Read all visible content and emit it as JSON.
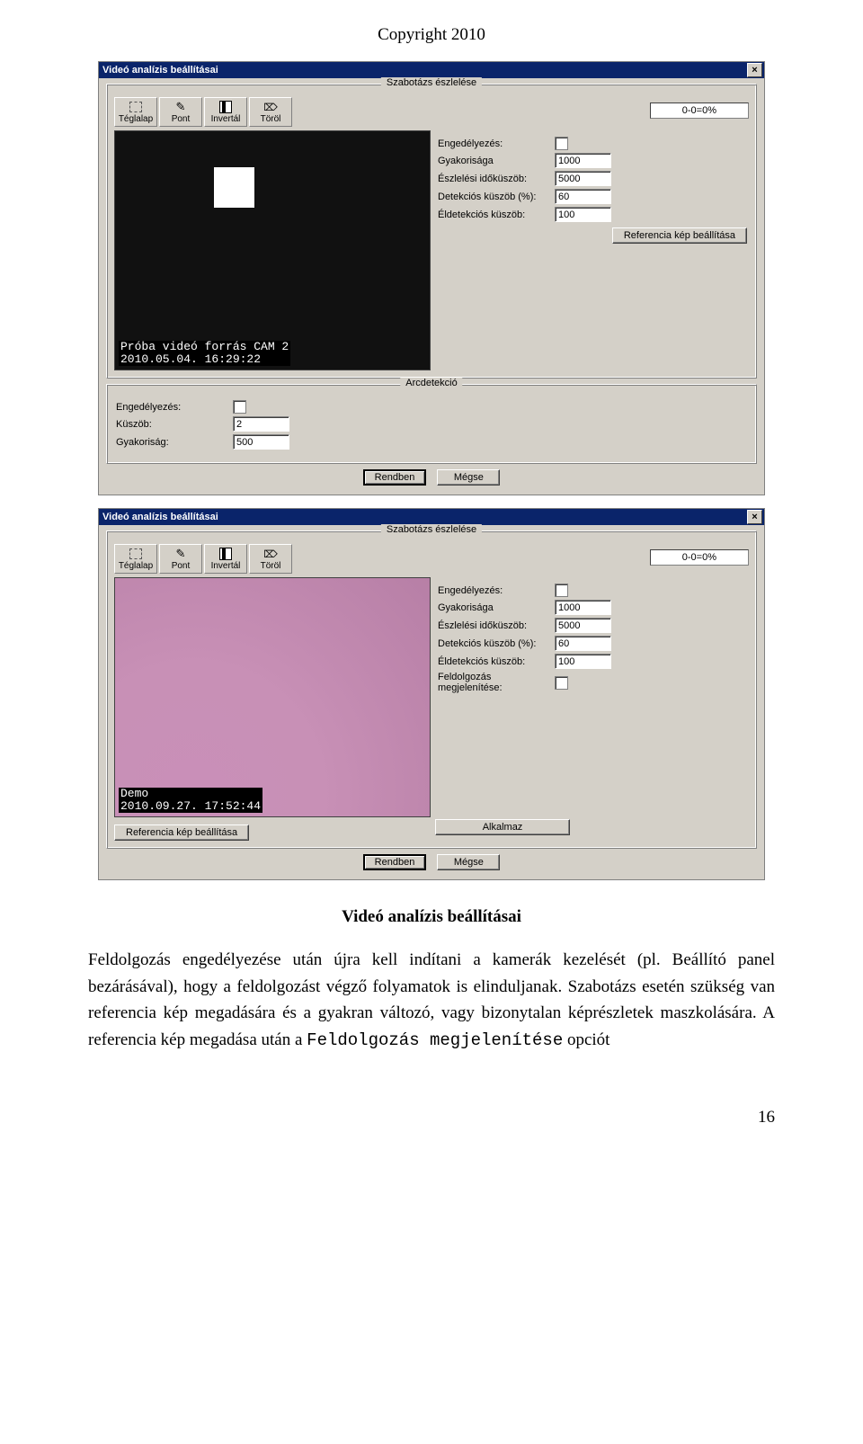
{
  "header": "Copyright 2010",
  "dialog1": {
    "title": "Videó analízis beállításai",
    "sabotage_legend": "Szabotázs észlelése",
    "face_legend": "Arcdetekció",
    "toolbar": {
      "rect": "Téglalap",
      "point": "Pont",
      "invert": "Invertál",
      "erase": "Töröl"
    },
    "status": "0-0=0%",
    "osd_line1": "Próba videó forrás CAM 2",
    "osd_line2": "2010.05.04. 16:29:22",
    "labels": {
      "enable": "Engedélyezés:",
      "freq": "Gyakorisága",
      "detect_time": "Észlelési időküszöb:",
      "detect_thresh": "Detekciós küszöb (%):",
      "edge_thresh": "Éldetekciós küszöb:"
    },
    "values": {
      "freq": "1000",
      "detect_time": "5000",
      "detect_thresh": "60",
      "edge_thresh": "100"
    },
    "ref_button": "Referencia kép beállítása",
    "face": {
      "labels": {
        "enable": "Engedélyezés:",
        "thresh": "Küszöb:",
        "freq": "Gyakoriság:"
      },
      "values": {
        "thresh": "2",
        "freq": "500"
      }
    },
    "buttons": {
      "ok": "Rendben",
      "cancel": "Mégse"
    }
  },
  "dialog2": {
    "title": "Videó analízis beállításai",
    "sabotage_legend": "Szabotázs észlelése",
    "toolbar": {
      "rect": "Téglalap",
      "point": "Pont",
      "invert": "Invertál",
      "erase": "Töröl"
    },
    "status": "0-0=0%",
    "osd_line1": "Demo",
    "osd_line2": "2010.09.27. 17:52:44",
    "labels": {
      "enable": "Engedélyezés:",
      "freq": "Gyakorisága",
      "detect_time": "Észlelési időküszöb:",
      "detect_thresh": "Detekciós küszöb (%):",
      "edge_thresh": "Éldetekciós küszöb:",
      "show_proc": "Feldolgozás megjelenítése:"
    },
    "values": {
      "freq": "1000",
      "detect_time": "5000",
      "detect_thresh": "60",
      "edge_thresh": "100"
    },
    "ref_button": "Referencia kép beállítása",
    "apply_button": "Alkalmaz",
    "buttons": {
      "ok": "Rendben",
      "cancel": "Mégse"
    }
  },
  "body": {
    "caption": "Videó analízis beállításai",
    "p1a": "Feldolgozás engedélyezése után újra kell indítani a kamerák kezelését (pl. Beállító panel bezárásával), hogy a feldolgozást végző folyamatok is elinduljanak. Szabotázs esetén szükség van referencia kép megadására és a gyakran változó, vagy bizonytalan képrészletek maszkolására. A referencia kép megadása után a ",
    "p1mono": "Feldolgozás megjelenítése",
    "p1b": " opciót"
  },
  "page_number": "16"
}
